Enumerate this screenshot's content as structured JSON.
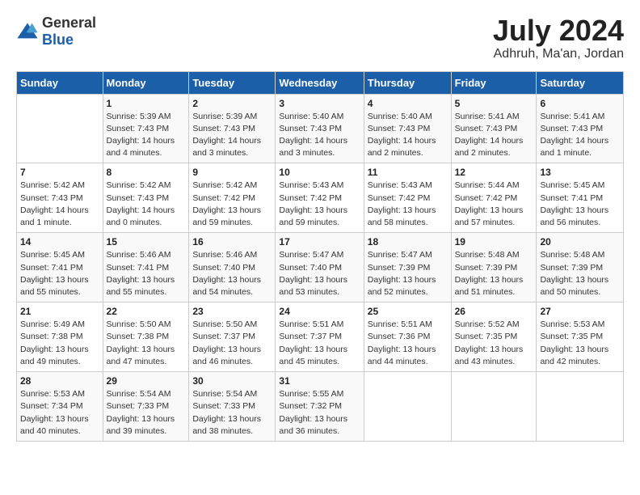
{
  "logo": {
    "general": "General",
    "blue": "Blue"
  },
  "title": "July 2024",
  "location": "Adhruh, Ma'an, Jordan",
  "days_header": [
    "Sunday",
    "Monday",
    "Tuesday",
    "Wednesday",
    "Thursday",
    "Friday",
    "Saturday"
  ],
  "weeks": [
    [
      {
        "day": "",
        "sunrise": "",
        "sunset": "",
        "daylight": ""
      },
      {
        "day": "1",
        "sunrise": "Sunrise: 5:39 AM",
        "sunset": "Sunset: 7:43 PM",
        "daylight": "Daylight: 14 hours and 4 minutes."
      },
      {
        "day": "2",
        "sunrise": "Sunrise: 5:39 AM",
        "sunset": "Sunset: 7:43 PM",
        "daylight": "Daylight: 14 hours and 3 minutes."
      },
      {
        "day": "3",
        "sunrise": "Sunrise: 5:40 AM",
        "sunset": "Sunset: 7:43 PM",
        "daylight": "Daylight: 14 hours and 3 minutes."
      },
      {
        "day": "4",
        "sunrise": "Sunrise: 5:40 AM",
        "sunset": "Sunset: 7:43 PM",
        "daylight": "Daylight: 14 hours and 2 minutes."
      },
      {
        "day": "5",
        "sunrise": "Sunrise: 5:41 AM",
        "sunset": "Sunset: 7:43 PM",
        "daylight": "Daylight: 14 hours and 2 minutes."
      },
      {
        "day": "6",
        "sunrise": "Sunrise: 5:41 AM",
        "sunset": "Sunset: 7:43 PM",
        "daylight": "Daylight: 14 hours and 1 minute."
      }
    ],
    [
      {
        "day": "7",
        "sunrise": "Sunrise: 5:42 AM",
        "sunset": "Sunset: 7:43 PM",
        "daylight": "Daylight: 14 hours and 1 minute."
      },
      {
        "day": "8",
        "sunrise": "Sunrise: 5:42 AM",
        "sunset": "Sunset: 7:43 PM",
        "daylight": "Daylight: 14 hours and 0 minutes."
      },
      {
        "day": "9",
        "sunrise": "Sunrise: 5:42 AM",
        "sunset": "Sunset: 7:42 PM",
        "daylight": "Daylight: 13 hours and 59 minutes."
      },
      {
        "day": "10",
        "sunrise": "Sunrise: 5:43 AM",
        "sunset": "Sunset: 7:42 PM",
        "daylight": "Daylight: 13 hours and 59 minutes."
      },
      {
        "day": "11",
        "sunrise": "Sunrise: 5:43 AM",
        "sunset": "Sunset: 7:42 PM",
        "daylight": "Daylight: 13 hours and 58 minutes."
      },
      {
        "day": "12",
        "sunrise": "Sunrise: 5:44 AM",
        "sunset": "Sunset: 7:42 PM",
        "daylight": "Daylight: 13 hours and 57 minutes."
      },
      {
        "day": "13",
        "sunrise": "Sunrise: 5:45 AM",
        "sunset": "Sunset: 7:41 PM",
        "daylight": "Daylight: 13 hours and 56 minutes."
      }
    ],
    [
      {
        "day": "14",
        "sunrise": "Sunrise: 5:45 AM",
        "sunset": "Sunset: 7:41 PM",
        "daylight": "Daylight: 13 hours and 55 minutes."
      },
      {
        "day": "15",
        "sunrise": "Sunrise: 5:46 AM",
        "sunset": "Sunset: 7:41 PM",
        "daylight": "Daylight: 13 hours and 55 minutes."
      },
      {
        "day": "16",
        "sunrise": "Sunrise: 5:46 AM",
        "sunset": "Sunset: 7:40 PM",
        "daylight": "Daylight: 13 hours and 54 minutes."
      },
      {
        "day": "17",
        "sunrise": "Sunrise: 5:47 AM",
        "sunset": "Sunset: 7:40 PM",
        "daylight": "Daylight: 13 hours and 53 minutes."
      },
      {
        "day": "18",
        "sunrise": "Sunrise: 5:47 AM",
        "sunset": "Sunset: 7:39 PM",
        "daylight": "Daylight: 13 hours and 52 minutes."
      },
      {
        "day": "19",
        "sunrise": "Sunrise: 5:48 AM",
        "sunset": "Sunset: 7:39 PM",
        "daylight": "Daylight: 13 hours and 51 minutes."
      },
      {
        "day": "20",
        "sunrise": "Sunrise: 5:48 AM",
        "sunset": "Sunset: 7:39 PM",
        "daylight": "Daylight: 13 hours and 50 minutes."
      }
    ],
    [
      {
        "day": "21",
        "sunrise": "Sunrise: 5:49 AM",
        "sunset": "Sunset: 7:38 PM",
        "daylight": "Daylight: 13 hours and 49 minutes."
      },
      {
        "day": "22",
        "sunrise": "Sunrise: 5:50 AM",
        "sunset": "Sunset: 7:38 PM",
        "daylight": "Daylight: 13 hours and 47 minutes."
      },
      {
        "day": "23",
        "sunrise": "Sunrise: 5:50 AM",
        "sunset": "Sunset: 7:37 PM",
        "daylight": "Daylight: 13 hours and 46 minutes."
      },
      {
        "day": "24",
        "sunrise": "Sunrise: 5:51 AM",
        "sunset": "Sunset: 7:37 PM",
        "daylight": "Daylight: 13 hours and 45 minutes."
      },
      {
        "day": "25",
        "sunrise": "Sunrise: 5:51 AM",
        "sunset": "Sunset: 7:36 PM",
        "daylight": "Daylight: 13 hours and 44 minutes."
      },
      {
        "day": "26",
        "sunrise": "Sunrise: 5:52 AM",
        "sunset": "Sunset: 7:35 PM",
        "daylight": "Daylight: 13 hours and 43 minutes."
      },
      {
        "day": "27",
        "sunrise": "Sunrise: 5:53 AM",
        "sunset": "Sunset: 7:35 PM",
        "daylight": "Daylight: 13 hours and 42 minutes."
      }
    ],
    [
      {
        "day": "28",
        "sunrise": "Sunrise: 5:53 AM",
        "sunset": "Sunset: 7:34 PM",
        "daylight": "Daylight: 13 hours and 40 minutes."
      },
      {
        "day": "29",
        "sunrise": "Sunrise: 5:54 AM",
        "sunset": "Sunset: 7:33 PM",
        "daylight": "Daylight: 13 hours and 39 minutes."
      },
      {
        "day": "30",
        "sunrise": "Sunrise: 5:54 AM",
        "sunset": "Sunset: 7:33 PM",
        "daylight": "Daylight: 13 hours and 38 minutes."
      },
      {
        "day": "31",
        "sunrise": "Sunrise: 5:55 AM",
        "sunset": "Sunset: 7:32 PM",
        "daylight": "Daylight: 13 hours and 36 minutes."
      },
      {
        "day": "",
        "sunrise": "",
        "sunset": "",
        "daylight": ""
      },
      {
        "day": "",
        "sunrise": "",
        "sunset": "",
        "daylight": ""
      },
      {
        "day": "",
        "sunrise": "",
        "sunset": "",
        "daylight": ""
      }
    ]
  ]
}
